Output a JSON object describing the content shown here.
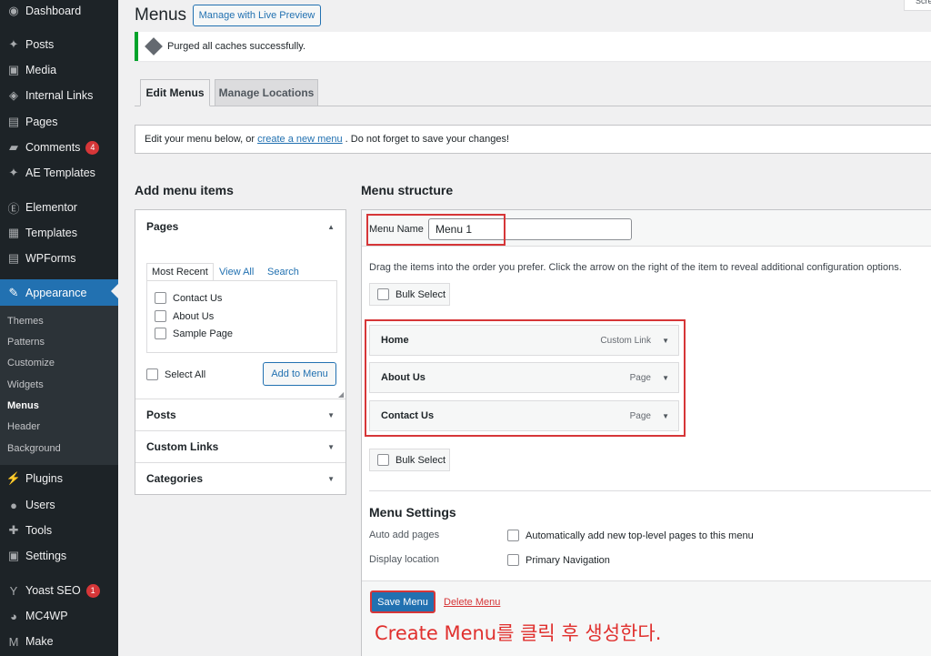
{
  "sidebar": {
    "items": [
      {
        "label": "Dashboard",
        "icon": "dashboard-icon",
        "glyph": "◉"
      },
      {
        "label": "Posts",
        "icon": "pin-icon",
        "glyph": "📌"
      },
      {
        "label": "Media",
        "icon": "media-icon",
        "glyph": "▣"
      },
      {
        "label": "Internal Links",
        "icon": "link-icon",
        "glyph": "◈"
      },
      {
        "label": "Pages",
        "icon": "pages-icon",
        "glyph": "▤"
      },
      {
        "label": "Comments",
        "icon": "comment-icon",
        "glyph": "▰",
        "badge": "4"
      },
      {
        "label": "AE Templates",
        "icon": "pin-icon",
        "glyph": "📌"
      },
      {
        "label": "Elementor",
        "icon": "elementor-icon",
        "glyph": "Ⓔ"
      },
      {
        "label": "Templates",
        "icon": "folder-icon",
        "glyph": "▦"
      },
      {
        "label": "WPForms",
        "icon": "forms-icon",
        "glyph": "▤"
      },
      {
        "label": "Appearance",
        "icon": "brush-icon",
        "glyph": "✎"
      },
      {
        "label": "Plugins",
        "icon": "plug-icon",
        "glyph": "⚡"
      },
      {
        "label": "Users",
        "icon": "user-icon",
        "glyph": "●"
      },
      {
        "label": "Tools",
        "icon": "wrench-icon",
        "glyph": "✚"
      },
      {
        "label": "Settings",
        "icon": "settings-icon",
        "glyph": "▣"
      },
      {
        "label": "Yoast SEO",
        "icon": "yoast-icon",
        "glyph": "Y",
        "badge": "1"
      },
      {
        "label": "MC4WP",
        "icon": "mailchimp-icon",
        "glyph": "◕"
      },
      {
        "label": "Make",
        "icon": "make-icon",
        "glyph": "M"
      }
    ],
    "submenu": [
      "Themes",
      "Patterns",
      "Customize",
      "Widgets",
      "Menus",
      "Header",
      "Background"
    ]
  },
  "header": {
    "title": "Menus",
    "live_preview_label": "Manage with Live Preview",
    "screen_options": "Scre"
  },
  "notice": {
    "text": "Purged all caches successfully."
  },
  "tabs": {
    "edit": "Edit Menus",
    "locations": "Manage Locations"
  },
  "intro": {
    "before": "Edit your menu below, or",
    "link": "create a new menu",
    "after": ". Do not forget to save your changes!"
  },
  "add_items": {
    "heading": "Add menu items",
    "pages_title": "Pages",
    "inner_tabs": [
      "Most Recent",
      "View All",
      "Search"
    ],
    "pages": [
      "Contact Us",
      "About Us",
      "Sample Page"
    ],
    "select_all": "Select All",
    "add_button": "Add to Menu",
    "sections": [
      "Posts",
      "Custom Links",
      "Categories"
    ]
  },
  "structure": {
    "heading": "Menu structure",
    "menu_name_label": "Menu Name",
    "menu_name_value": "Menu 1",
    "instructions": "Drag the items into the order you prefer. Click the arrow on the right of the item to reveal additional configuration options.",
    "bulk_select": "Bulk Select",
    "items": [
      {
        "title": "Home",
        "type": "Custom Link"
      },
      {
        "title": "About Us",
        "type": "Page"
      },
      {
        "title": "Contact Us",
        "type": "Page"
      }
    ],
    "settings_heading": "Menu Settings",
    "auto_add_label": "Auto add pages",
    "auto_add_option": "Automatically add new top-level pages to this menu",
    "display_label": "Display location",
    "display_option": "Primary Navigation",
    "save_label": "Save Menu",
    "delete_label": "Delete Menu"
  },
  "caption": "Create Menu를 클릭 후 생성한다.",
  "colors": {
    "accent": "#2271b1",
    "highlight": "#d63638",
    "sidebar": "#1d2327",
    "success": "#00a32a"
  }
}
